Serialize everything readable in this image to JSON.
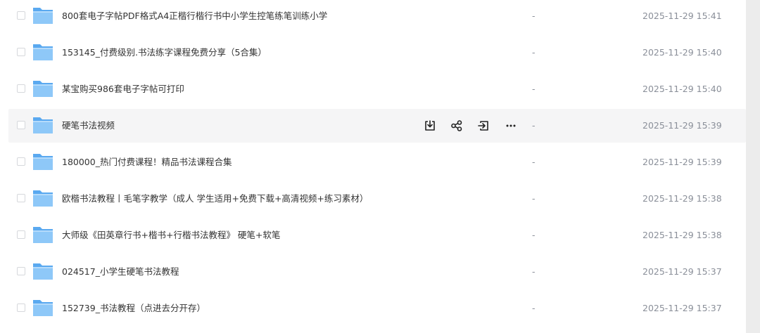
{
  "files": [
    {
      "name": "800套电子字帖PDF格式A4正楷行楷行书中小学生控笔练笔训练小学",
      "size": "-",
      "modified": "2025-11-29 15:41"
    },
    {
      "name": "153145_付费级别.书法练字课程免费分享（5合集）",
      "size": "-",
      "modified": "2025-11-29 15:40"
    },
    {
      "name": "某宝购买986套电子字帖可打印",
      "size": "-",
      "modified": "2025-11-29 15:40"
    },
    {
      "name": "硬笔书法视频",
      "size": "-",
      "modified": "2025-11-29 15:39"
    },
    {
      "name": "180000_热门付费课程！精品书法课程合集",
      "size": "-",
      "modified": "2025-11-29 15:39"
    },
    {
      "name": "欧楷书法教程丨毛笔字教学（成人 学生适用+免费下载+高清视频+练习素材）",
      "size": "-",
      "modified": "2025-11-29 15:38"
    },
    {
      "name": "大师级《田英章行书+楷书+行楷书法教程》 硬笔+软笔",
      "size": "-",
      "modified": "2025-11-29 15:38"
    },
    {
      "name": "024517_小学生硬笔书法教程",
      "size": "-",
      "modified": "2025-11-29 15:37"
    },
    {
      "name": "152739_书法教程（点进去分开存）",
      "size": "-",
      "modified": "2025-11-29 15:37"
    }
  ],
  "hovered_row": 3,
  "row_actions": [
    "download-icon",
    "share-icon",
    "move-icon",
    "more-icon"
  ],
  "colors": {
    "folder": "#5aa9f0",
    "folder_light": "#8ec8f8",
    "hover_bg": "#f5f5f6",
    "meta_text": "#8a8f99"
  }
}
